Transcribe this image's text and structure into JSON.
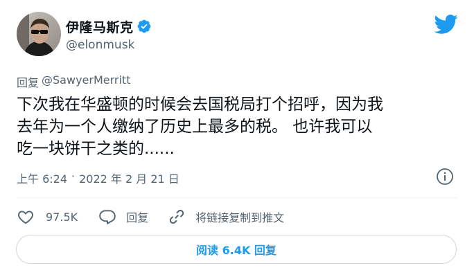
{
  "author": {
    "name": "伊隆马斯克",
    "handle": "@elonmusk"
  },
  "reply": {
    "prefix": "回复",
    "mention": "@SawyerMerritt"
  },
  "tweet": {
    "lines": [
      "下次我在华盛顿的时候会去国税局打个招呼，因为我",
      "去年为一个人缴纳了历史上最多的税。 也许我可以",
      "吃一块饼干之类的......"
    ]
  },
  "meta": {
    "time": "上午 6:24",
    "separator": "·",
    "date": "2022 年 2 月 21 日"
  },
  "actions": {
    "likes": "97.5K",
    "reply_label": "回复",
    "copy_link_label": "将链接复制到推文"
  },
  "read_button": {
    "label": "阅读 6.4K 回复"
  },
  "colors": {
    "accent": "#1d9bf0",
    "text": "#0f1419",
    "secondary": "#536471",
    "border": "#cfd9de"
  },
  "icons": [
    "avatar",
    "verified-badge-icon",
    "twitter-bird-icon",
    "info-icon",
    "heart-icon",
    "reply-bubble-icon",
    "link-icon"
  ]
}
